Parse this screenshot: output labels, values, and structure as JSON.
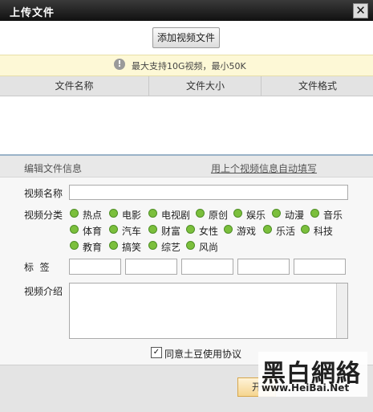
{
  "window": {
    "title": "上传文件",
    "close_glyph": "✕"
  },
  "upload": {
    "add_button": "添加视频文件"
  },
  "notice": {
    "icon": "info-icon",
    "icon_glyph": "!",
    "text": "最大支持10G视频，最小50K"
  },
  "file_table": {
    "columns": [
      "文件名称",
      "文件大小",
      "文件格式"
    ]
  },
  "edit": {
    "title": "编辑文件信息",
    "autofill_link": "用上个视频信息自动填写"
  },
  "form": {
    "name_label": "视频名称",
    "category_label": "视频分类",
    "categories": [
      "热点",
      "电影",
      "电视剧",
      "原创",
      "娱乐",
      "动漫",
      "音乐",
      "体育",
      "汽车",
      "财富",
      "女性",
      "游戏",
      "乐活",
      "科技",
      "教育",
      "搞笑",
      "综艺",
      "风尚"
    ],
    "tags_label": "标  签",
    "desc_label": "视频介绍",
    "agree_label": "同意土豆使用协议",
    "agree_checked": true
  },
  "footer": {
    "start_button": "开"
  },
  "watermark": {
    "text": "黑白網絡",
    "url": "www.HeiBai.Net"
  }
}
